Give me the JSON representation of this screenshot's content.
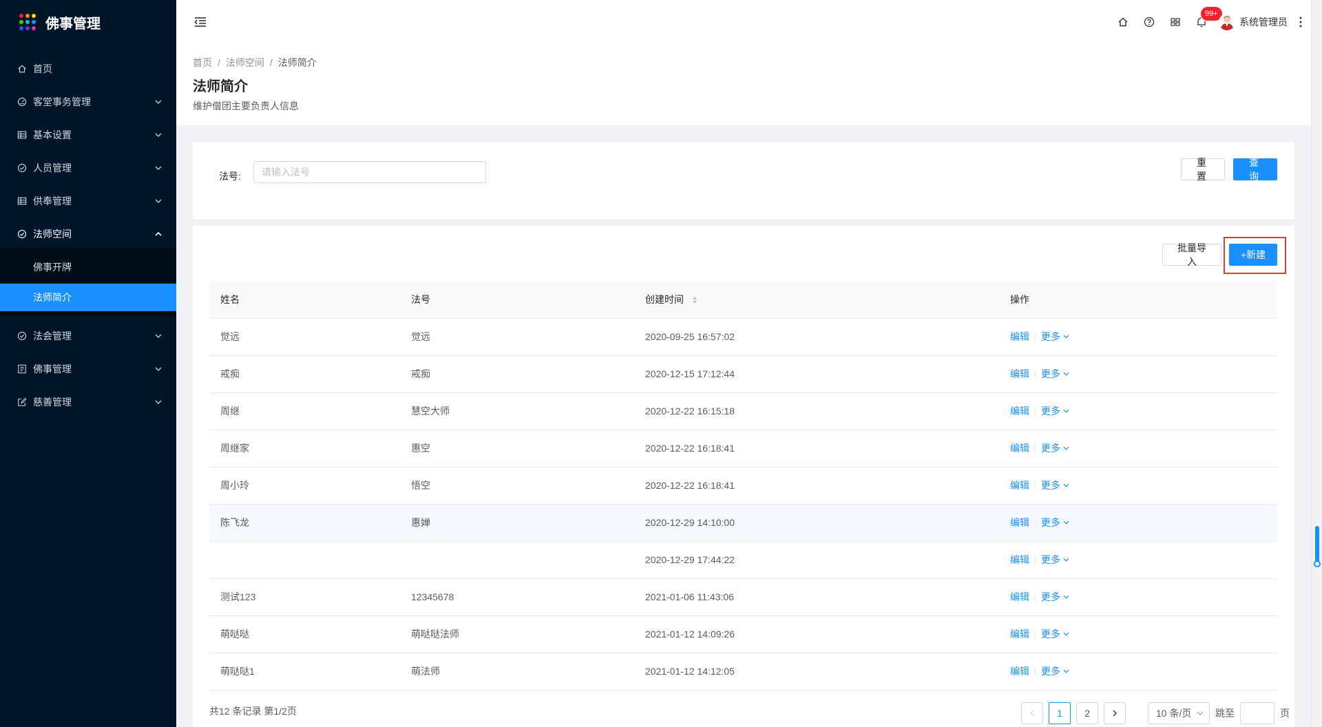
{
  "app": {
    "title": "佛事管理",
    "logo_colors": [
      "#f5222d",
      "#fa8c16",
      "#fadb14",
      "#52c41a",
      "#13c2c2",
      "#1890ff",
      "#2f54eb",
      "#722ed1",
      "#eb2f96"
    ]
  },
  "colors": {
    "sidebar_bg": "#001529",
    "accent": "#1890ff",
    "highlight": "#e53935",
    "badge": "#f5222d"
  },
  "sidebar": {
    "items": [
      {
        "label": "首页",
        "icon": "home-icon",
        "has_arrow": false
      },
      {
        "label": "客堂事务管理",
        "icon": "dashboard-icon",
        "has_arrow": true
      },
      {
        "label": "基本设置",
        "icon": "table-icon",
        "has_arrow": true
      },
      {
        "label": "人员管理",
        "icon": "check-circle-icon",
        "has_arrow": true
      },
      {
        "label": "供奉管理",
        "icon": "table-icon",
        "has_arrow": true
      },
      {
        "label": "法师空间",
        "icon": "check-circle-icon",
        "has_arrow": true,
        "open": true,
        "children": [
          {
            "label": "佛事开牌",
            "active": false
          },
          {
            "label": "法师简介",
            "active": true
          }
        ]
      },
      {
        "label": "法会管理",
        "icon": "check-circle-icon",
        "has_arrow": true
      },
      {
        "label": "佛事管理",
        "icon": "profile-icon",
        "has_arrow": true
      },
      {
        "label": "慈善管理",
        "icon": "form-icon",
        "has_arrow": true
      }
    ]
  },
  "header": {
    "badge": "99+",
    "user_name": "系统管理员"
  },
  "breadcrumb": [
    "首页",
    "法师空间",
    "法师简介"
  ],
  "page": {
    "title": "法师简介",
    "description": "维护僧团主要负责人信息"
  },
  "search": {
    "label": "法号:",
    "placeholder": "请输入法号",
    "value": "",
    "reset_label": "重置",
    "query_label": "查询"
  },
  "toolbar": {
    "import_label": "批量导入",
    "new_label": "+新建"
  },
  "table": {
    "columns": [
      "姓名",
      "法号",
      "创建时间",
      "操作"
    ],
    "rows": [
      {
        "name": "觉远",
        "dharma": "觉远",
        "created": "2020-09-25 16:57:02"
      },
      {
        "name": "戒痴",
        "dharma": "戒痴",
        "created": "2020-12-15 17:12:44"
      },
      {
        "name": "周继",
        "dharma": "慧空大师",
        "created": "2020-12-22 16:15:18"
      },
      {
        "name": "周继家",
        "dharma": "惠空",
        "created": "2020-12-22 16:18:41"
      },
      {
        "name": "周小玲",
        "dharma": "悟空",
        "created": "2020-12-22 16:18:41"
      },
      {
        "name": "陈飞龙",
        "dharma": "惠婵",
        "created": "2020-12-29 14:10:00"
      },
      {
        "name": "",
        "dharma": "",
        "created": "2020-12-29 17:44:22"
      },
      {
        "name": "测试123",
        "dharma": "12345678",
        "created": "2021-01-06 11:43:06"
      },
      {
        "name": "萌哒哒",
        "dharma": "萌哒哒法师",
        "created": "2021-01-12 14:09:26"
      },
      {
        "name": "萌哒哒1",
        "dharma": "萌法师",
        "created": "2021-01-12 14:12:05"
      }
    ],
    "edit_label": "编辑",
    "more_label": "更多"
  },
  "pagination": {
    "summary": "共12 条记录 第1/2页",
    "pages": [
      "1",
      "2"
    ],
    "current": "1",
    "page_size": "10 条/页",
    "jump_label": "跳至",
    "page_unit": "页"
  }
}
